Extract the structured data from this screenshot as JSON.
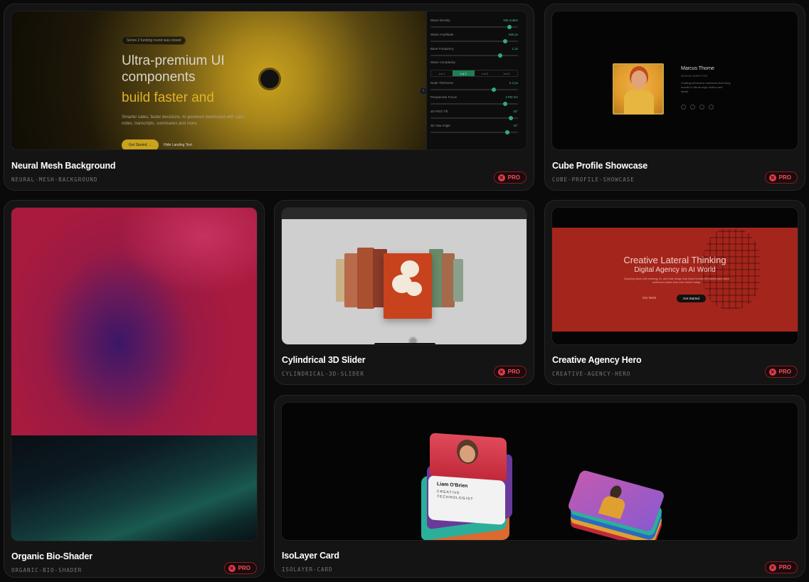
{
  "cards": [
    {
      "id": "neural",
      "title": "Neural Mesh Background",
      "slug": "NEURAL-MESH-BACKGROUND",
      "badge": "PRO"
    },
    {
      "id": "cube",
      "title": "Cube Profile Showcase",
      "slug": "CUBE-PROFILE-SHOWCASE",
      "badge": "PRO"
    },
    {
      "id": "bio",
      "title": "Organic Bio-Shader",
      "slug": "ORGANIC-BIO-SHADER",
      "badge": "PRO"
    },
    {
      "id": "cyl",
      "title": "Cylindrical 3D Slider",
      "slug": "CYLINDRICAL-3D-SLIDER",
      "badge": "PRO"
    },
    {
      "id": "agency",
      "title": "Creative Agency Hero",
      "slug": "CREATIVE-AGENCY-HERO",
      "badge": "PRO"
    },
    {
      "id": "iso",
      "title": "IsoLayer Card",
      "slug": "ISOLAYER-CARD",
      "badge": "PRO"
    }
  ],
  "neural_preview": {
    "pill": "Series 2 funding round was closed",
    "headline": "Ultra-premium UI components",
    "headline_accent": "build faster and",
    "description": "Smarter sales, faster decisions. AI-powered dashboard with calls, notes, transcripts, summaries and more.",
    "cta_primary": "Get Started →",
    "cta_secondary": "Hide Landing Text",
    "controls": [
      {
        "label": "Wave Density",
        "value": "165 nodes",
        "level": 0.9
      },
      {
        "label": "Wave Amplitude",
        "value": "165 px",
        "level": 0.85
      },
      {
        "label": "Base Frequency",
        "value": "1.2x",
        "level": 0.8
      },
      {
        "label": "Wave Complexity",
        "value": "",
        "level": null
      },
      {
        "label": "Node Thickness",
        "value": "2.2 px",
        "level": 0.72
      },
      {
        "label": "Perspective Focus",
        "value": "1700 nm",
        "level": 0.85
      },
      {
        "label": "3D Pitch Tilt",
        "value": "45°",
        "level": 0.92
      },
      {
        "label": "3D Yaw Angle",
        "value": "10°",
        "level": 0.88
      }
    ],
    "complexity_options": [
      "Lvl 1",
      "Lvl 2",
      "Lvl 3",
      "Lvl 4"
    ],
    "complexity_selected": 1
  },
  "cube_preview": {
    "name": "Marcus Thorne",
    "role": "DESIGN DIRECTOR",
    "bio": "Crafting immersive interfaces that bring brands to life through motion and depth."
  },
  "agency_preview": {
    "headline": "Creative Lateral Thinking",
    "subheadline": "Digital Agency in AI World",
    "description": "Sparking ideas with strategy, AI, and bold design that helps brands tell stories and reach audiences faster than ever before today.",
    "cta_secondary": "Our Work",
    "cta_primary": "Get Started"
  },
  "iso_preview": {
    "name": "Liam O'Brien",
    "role_line1": "CREATIVE",
    "role_line2": "TECHNOLOGIST"
  },
  "colors": {
    "pro_accent": "#ff4d5a",
    "neural_gold": "#e0b326",
    "agency_red": "#a4251c",
    "control_green": "#2fae78"
  }
}
